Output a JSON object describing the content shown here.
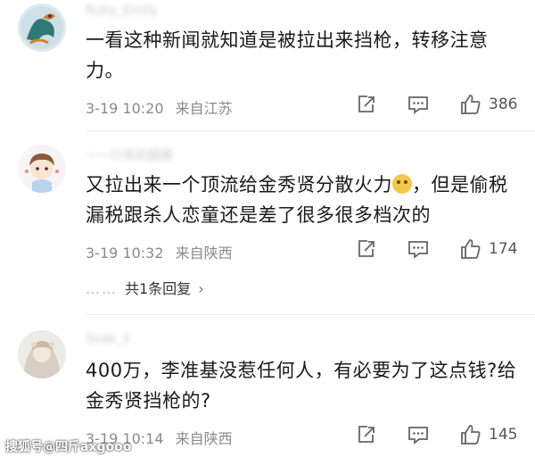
{
  "comments": [
    {
      "username": "Ruby_Emily",
      "text": "一看这种新闻就知道是被拉出来挡枪，转移注意力。",
      "time": "3-19 10:20",
      "location": "来自江苏",
      "likes": "386"
    },
    {
      "username": "一一只有机狐狸",
      "text_before_emoji": "又拉出来一个顶流给金秀贤分散火力",
      "text_after_emoji": "，但是偷税漏税跟杀人恋童还是差了很多很多档次的",
      "time": "3-19 10:32",
      "location": "来自陕西",
      "likes": "174",
      "replies_label": "共1条回复",
      "replies_dots": "……",
      "replies_chevron": "›"
    },
    {
      "username": "Soak_3",
      "text": "400万，李准基没惹任何人，有必要为了这点钱?给金秀贤挡枪的?",
      "time": "3-19 10:14",
      "location": "来自陕西",
      "likes": "145"
    }
  ],
  "icons": [
    "share-icon",
    "comment-icon",
    "like-icon"
  ],
  "watermark": "搜狐号@四斤axgooo"
}
